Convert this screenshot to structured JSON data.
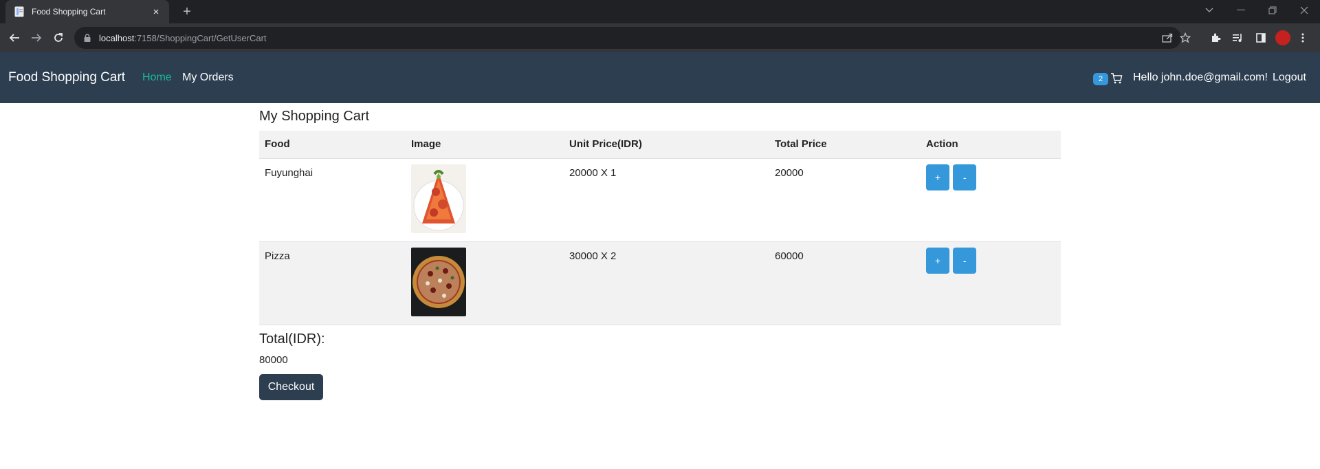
{
  "browser": {
    "tab_title": "Food Shopping Cart",
    "tab_close": "×",
    "new_tab": "+",
    "url_host": "localhost",
    "url_rest": ":7158/ShoppingCart/GetUserCart"
  },
  "navbar": {
    "brand": "Food Shopping Cart",
    "links": [
      {
        "label": "Home",
        "active": true
      },
      {
        "label": "My Orders",
        "active": false
      }
    ],
    "cart_count": "2",
    "greeting": "Hello john.doe@gmail.com!",
    "logout": "Logout",
    "colors": {
      "bar": "#2c3e50",
      "active_link": "#18bc9c",
      "badge": "#3498db"
    }
  },
  "cart": {
    "title": "My Shopping Cart",
    "columns": [
      "Food",
      "Image",
      "Unit Price(IDR)",
      "Total Price",
      "Action"
    ],
    "rows": [
      {
        "food": "Fuyunghai",
        "unit": "20000 X 1",
        "total": "20000",
        "image_icon": "fuyunghai-photo"
      },
      {
        "food": "Pizza",
        "unit": "30000 X 2",
        "total": "60000",
        "image_icon": "pizza-photo"
      }
    ],
    "add_label": "+",
    "remove_label": "-",
    "total_label": "Total(IDR):",
    "total_value": "80000",
    "checkout_label": "Checkout"
  }
}
